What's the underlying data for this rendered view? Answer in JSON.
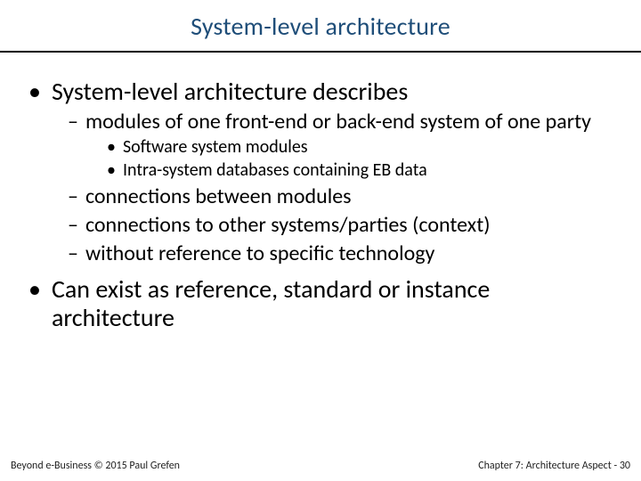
{
  "title": "System-level architecture",
  "bullets": {
    "b1": "System-level architecture describes",
    "b1a": "modules of one front-end or back-end system of one party",
    "b1a1": "Software system modules",
    "b1a2": "Intra-system databases containing EB data",
    "b1b": "connections between modules",
    "b1c": "connections to other systems/parties (context)",
    "b1d": "without reference to specific technology",
    "b2": "Can exist as reference, standard or instance architecture"
  },
  "footer": {
    "left": "Beyond e-Business © 2015 Paul Grefen",
    "right": "Chapter 7: Architecture Aspect - 30"
  }
}
